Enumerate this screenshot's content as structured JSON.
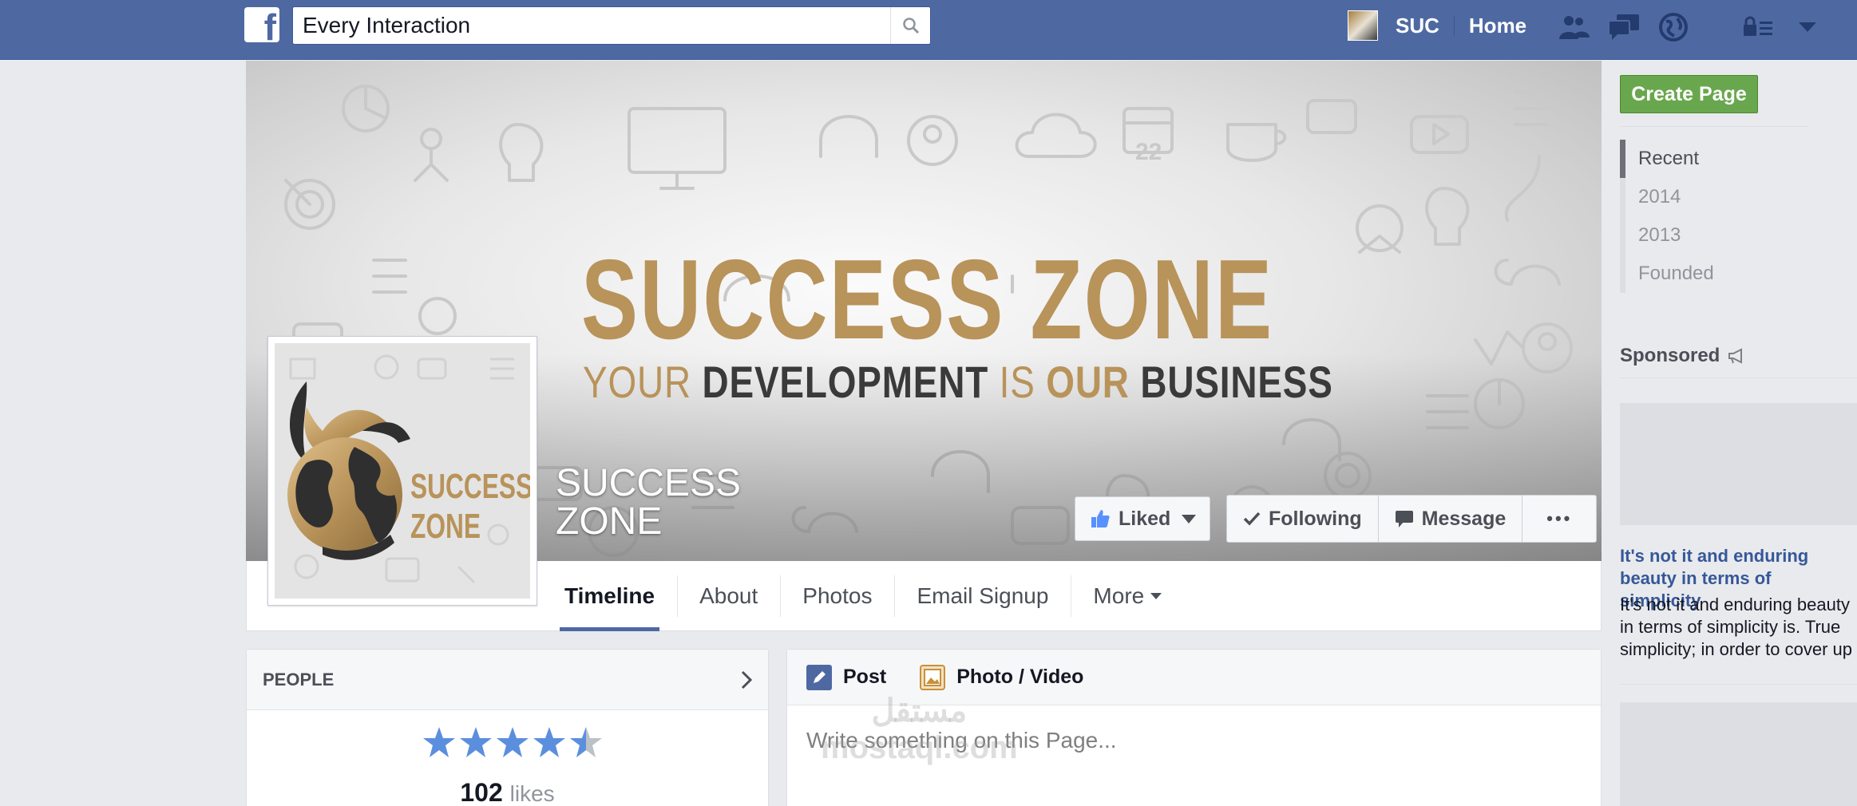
{
  "topbar": {
    "logo": "f",
    "search_value": "Every Interaction",
    "user_name": "SUC",
    "home_label": "Home",
    "icons": [
      "friends-icon",
      "messages-icon",
      "notifications-globe-icon",
      "privacy-lock-icon",
      "account-dropdown-icon"
    ]
  },
  "cover": {
    "title": "SUCCESS ZONE",
    "tagline": {
      "w1": "YOUR ",
      "w2": "DEVELOPMENT",
      "w3": " IS ",
      "w4": "OUR",
      "w5": " BUSINESS"
    },
    "doodle_number": "22"
  },
  "profile_pic": {
    "line1": "SUCCESS",
    "line2": "ZONE"
  },
  "page_name": {
    "line1": "SUCCESS",
    "line2": "ZONE"
  },
  "actions": {
    "liked": "Liked",
    "following": "Following",
    "message": "Message",
    "more_dots": "•••"
  },
  "tabs": [
    "Timeline",
    "About",
    "Photos",
    "Email Signup",
    "More"
  ],
  "people": {
    "title": "PEOPLE",
    "rating": 4.5,
    "likes_count": "102",
    "likes_label": "likes"
  },
  "composer": {
    "post_label": "Post",
    "photo_label": "Photo / Video",
    "placeholder": "Write something on this Page..."
  },
  "watermark": {
    "arabic": "مستقل",
    "site": "mostaql.com"
  },
  "sidebar": {
    "create_page": "Create Page",
    "years": [
      "Recent",
      "2014",
      "2013",
      "Founded"
    ],
    "sponsored": "Sponsored",
    "ad_title": "It's not it and enduring beauty in terms of simplicity",
    "ad_body": "It's not it and enduring beauty in terms of simplicity is. True simplicity; in order to cover up"
  },
  "colors": {
    "topbar": "#4e69a2",
    "gold": "#b8935a",
    "dark": "#3a3a3a",
    "create_green": "#69a74e",
    "link_blue": "#365899",
    "tab_underline": "#4e69a2"
  }
}
